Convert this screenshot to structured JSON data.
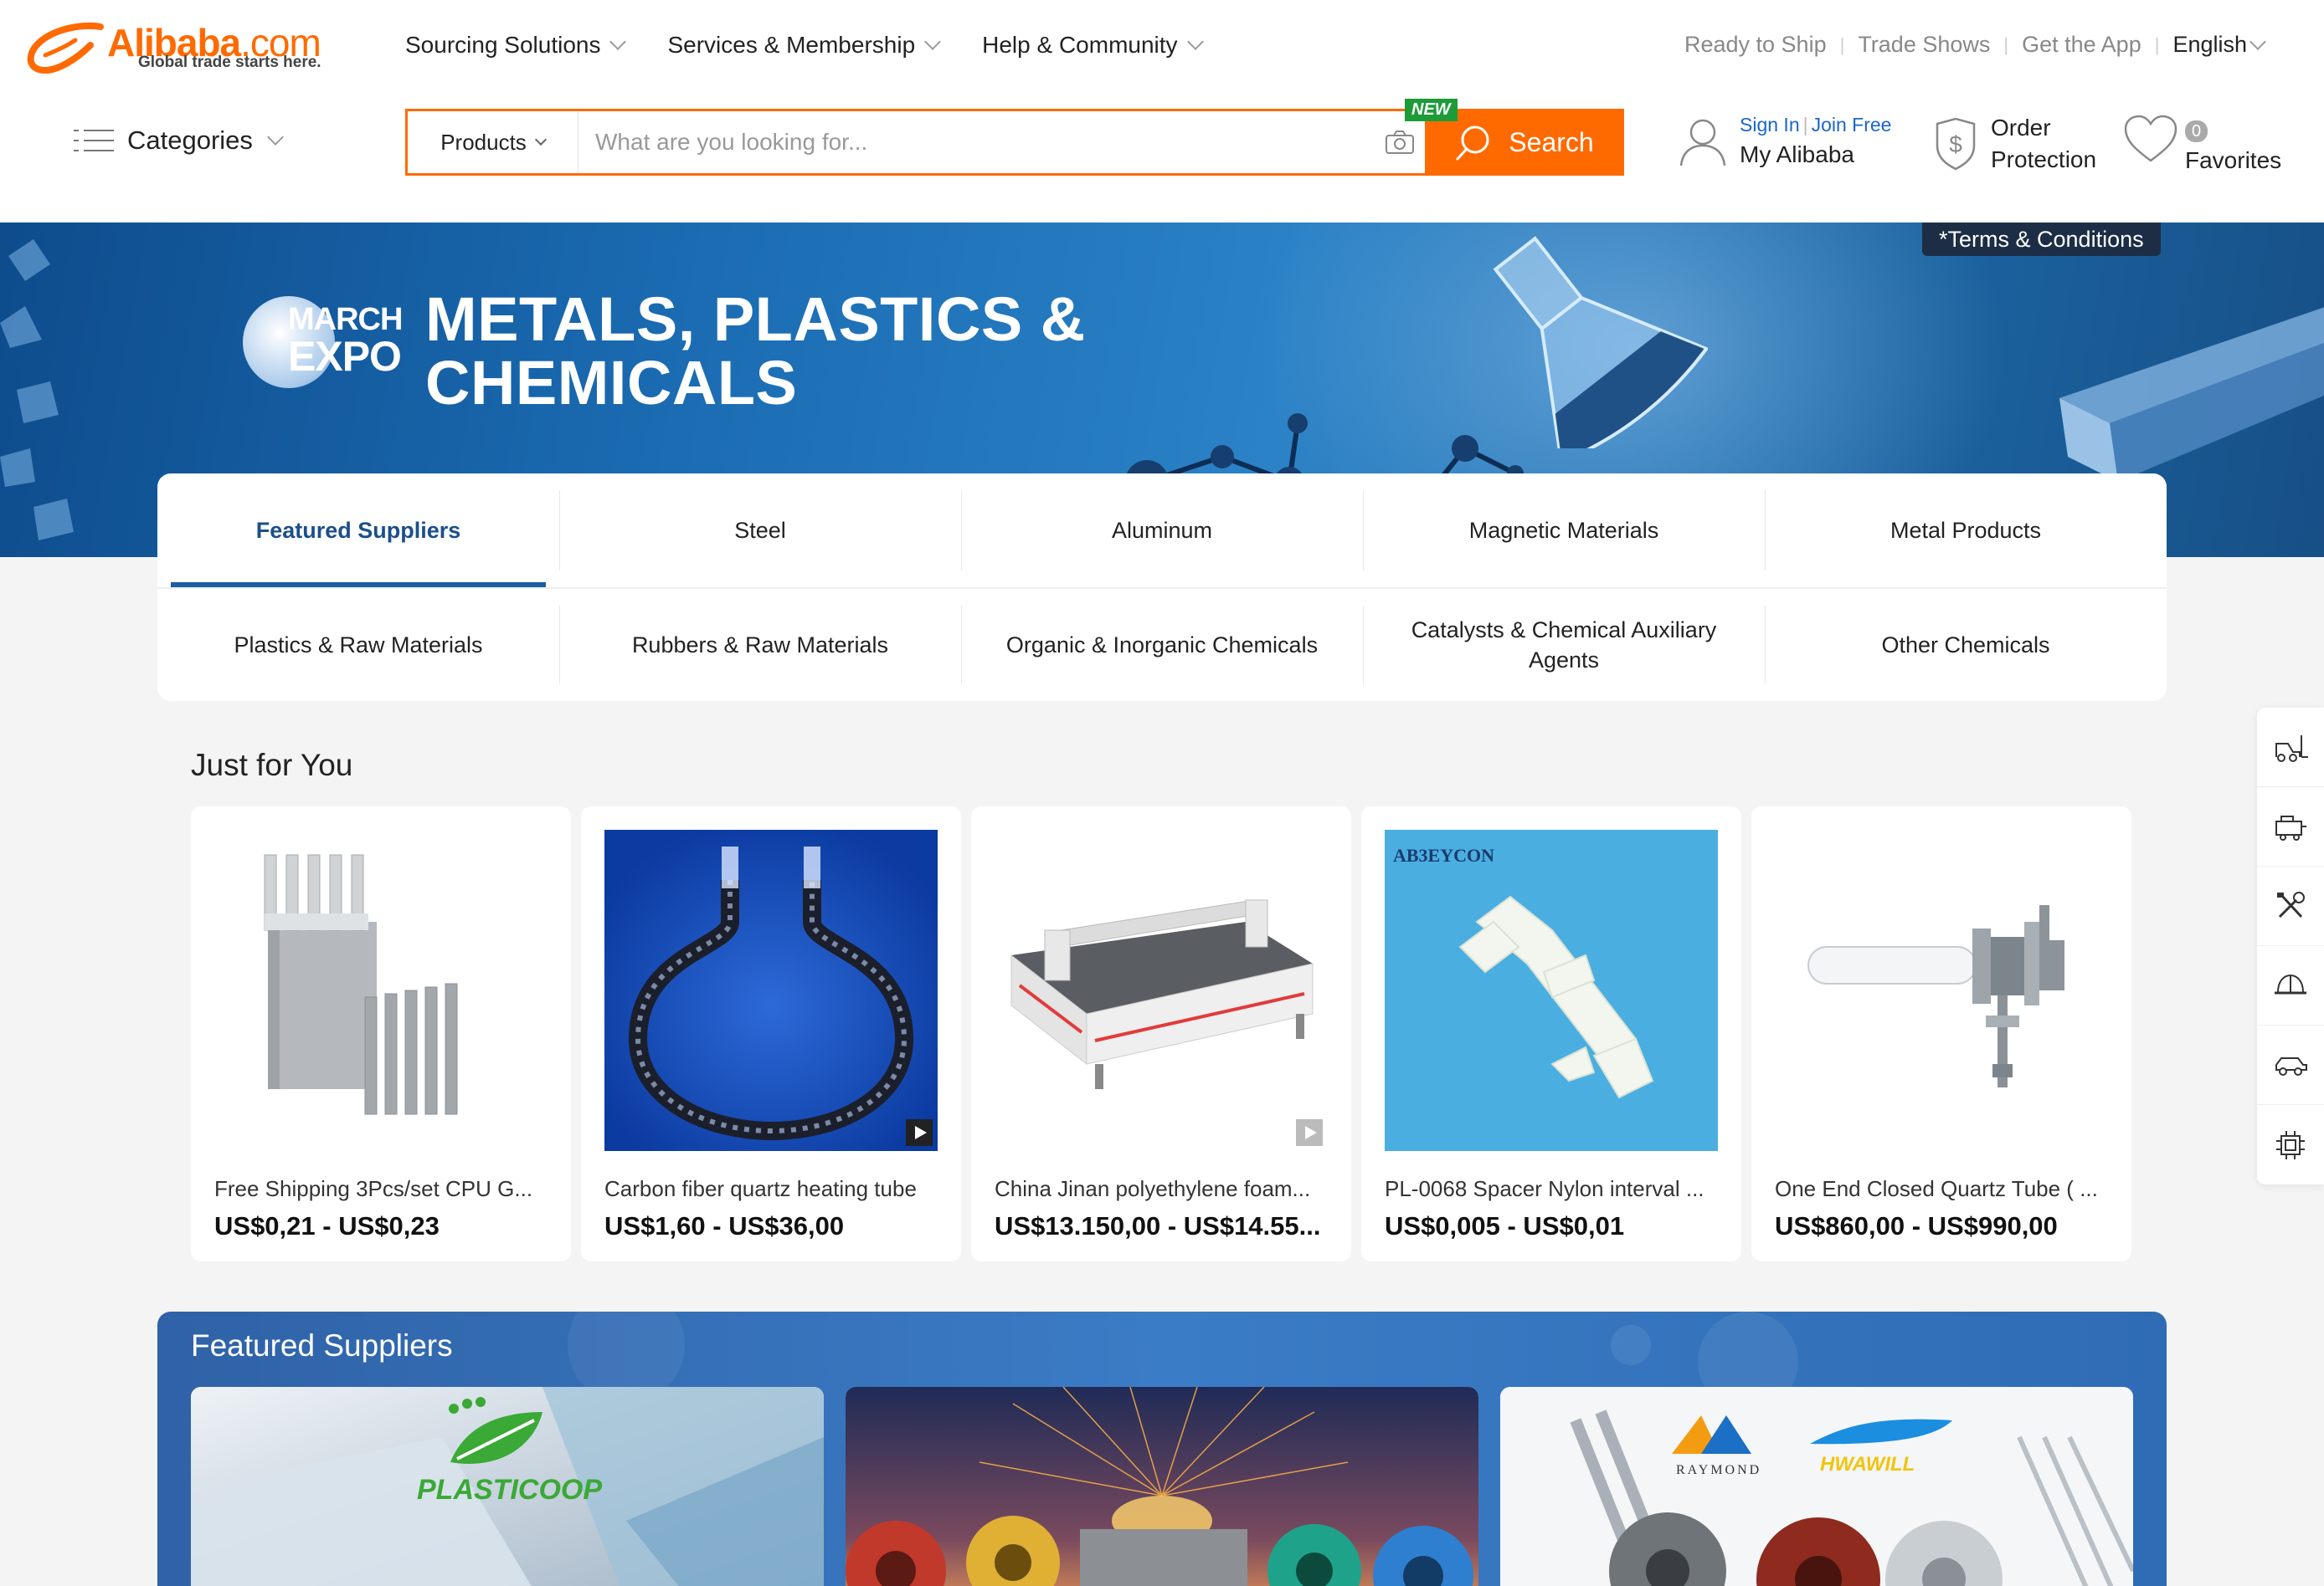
{
  "header": {
    "logo": {
      "brand": "Alibaba",
      "suffix": ".com",
      "tagline": "Global trade starts here."
    },
    "nav": [
      {
        "label": "Sourcing Solutions"
      },
      {
        "label": "Services & Membership"
      },
      {
        "label": "Help & Community"
      }
    ],
    "top_links": [
      "Ready to Ship",
      "Trade Shows",
      "Get the App"
    ],
    "language": "English",
    "categories_label": "Categories",
    "search": {
      "category": "Products",
      "placeholder": "What are you looking for...",
      "button_label": "Search",
      "new_badge": "NEW"
    },
    "account": {
      "sign_in": "Sign In",
      "join": "Join Free",
      "my_alibaba": "My Alibaba"
    },
    "order": {
      "line1": "Order",
      "line2": "Protection"
    },
    "favorites": {
      "count": "0",
      "label": "Favorites"
    }
  },
  "banner": {
    "badge_line1": "MARCH",
    "badge_line2": "EXPO",
    "title_line1": "METALS, PLASTICS &",
    "title_line2": "CHEMICALS",
    "terms_label": "*Terms & Conditions"
  },
  "tabs": {
    "row1": [
      "Featured Suppliers",
      "Steel",
      "Aluminum",
      "Magnetic Materials",
      "Metal Products"
    ],
    "row2": [
      "Plastics & Raw Materials",
      "Rubbers & Raw Materials",
      "Organic & Inorganic Chemicals",
      "Catalysts & Chemical Auxiliary Agents",
      "Other Chemicals"
    ],
    "active": "Featured Suppliers"
  },
  "just_for_you": {
    "title": "Just for You",
    "products": [
      {
        "name": "Free Shipping 3Pcs/set CPU G...",
        "price": "US$0,21 - US$0,23"
      },
      {
        "name": "Carbon fiber quartz heating tube",
        "price": "US$1,60 - US$36,00"
      },
      {
        "name": "China Jinan polyethylene foam...",
        "price": "US$13.150,00 - US$14.55..."
      },
      {
        "name": "PL-0068 Spacer Nylon interval ...",
        "price": "US$0,005 - US$0,01"
      },
      {
        "name": "One End Closed Quartz Tube ( ...",
        "price": "US$860,00 - US$990,00"
      }
    ]
  },
  "featured_suppliers": {
    "title": "Featured Suppliers",
    "logos": [
      "PLASTICOOP",
      "RAYMOND",
      "HWAWILL"
    ]
  },
  "product_image_text": {
    "spacer_brand": "AB3EYCON"
  },
  "side_toolbar": [
    "forklift-icon",
    "machinery-icon",
    "tools-icon",
    "safety-helmet-icon",
    "car-icon",
    "chip-icon"
  ],
  "colors": {
    "brand_orange": "#ff6a00",
    "active_tab_blue": "#1b5ea3",
    "link_blue": "#1a66c9",
    "new_badge_green": "#1c9b38"
  }
}
